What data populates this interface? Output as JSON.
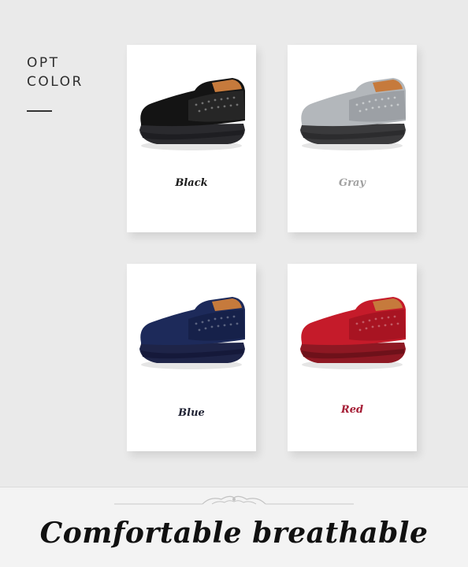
{
  "header": {
    "line1": "OPT",
    "line2": "COLOR"
  },
  "options": [
    {
      "label": "Black",
      "label_color": "#1a1a1a",
      "upper": "#141414",
      "upper_shade": "#262626",
      "sole": "#2a2a2e",
      "sole_band": "#1e1e22"
    },
    {
      "label": "Gray",
      "label_color": "#a0a0a0",
      "upper": "#b3b7bb",
      "upper_shade": "#9ca0a5",
      "sole": "#3a3a3c",
      "sole_band": "#2c2c2e"
    },
    {
      "label": "Blue",
      "label_color": "#1f2233",
      "upper": "#1d2a5a",
      "upper_shade": "#16214a",
      "sole": "#1e2448",
      "sole_band": "#15193a"
    },
    {
      "label": "Red",
      "label_color": "#a51d35",
      "upper": "#c51b2a",
      "upper_shade": "#a81422",
      "sole": "#8e1823",
      "sole_band": "#6e111a"
    }
  ],
  "footer": {
    "tagline": "Comfortable breathable"
  }
}
